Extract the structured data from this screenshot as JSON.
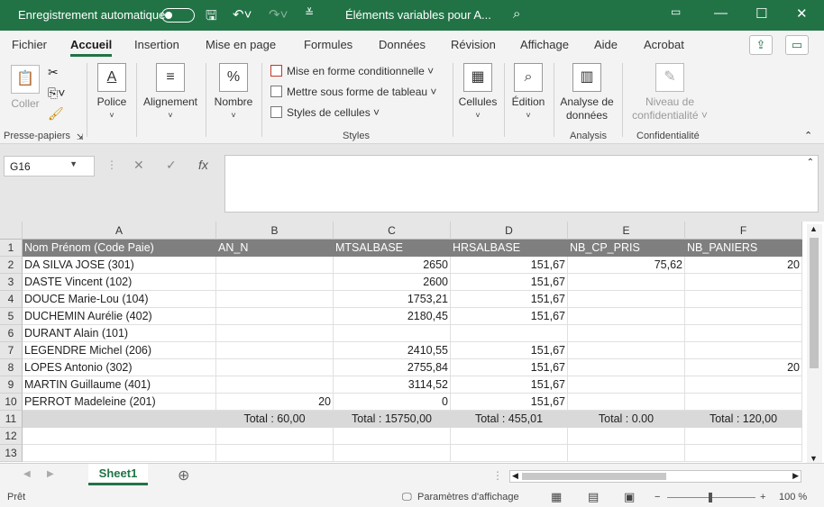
{
  "titlebar": {
    "autosave_label": "Enregistrement automatique",
    "doc_title": "Éléments variables pour A..."
  },
  "menu": {
    "tabs": [
      "Fichier",
      "Accueil",
      "Insertion",
      "Mise en page",
      "Formules",
      "Données",
      "Révision",
      "Affichage",
      "Aide",
      "Acrobat"
    ],
    "active": "Accueil"
  },
  "ribbon": {
    "coller": "Coller",
    "presse_papiers": "Presse-papiers",
    "police": "Police",
    "alignement": "Alignement",
    "nombre": "Nombre",
    "mise_en_forme": "Mise en forme conditionnelle",
    "mettre_tableau": "Mettre sous forme de tableau",
    "styles_cellules": "Styles de cellules",
    "styles": "Styles",
    "cellules": "Cellules",
    "edition": "Édition",
    "analyse1": "Analyse de",
    "analyse2": "données",
    "analysis": "Analysis",
    "niveau1": "Niveau de",
    "niveau2": "confidentialité",
    "confidentialite": "Confidentialité"
  },
  "formula": {
    "cell_ref": "G16",
    "fx": "fx"
  },
  "columns": [
    "A",
    "B",
    "C",
    "D",
    "E",
    "F"
  ],
  "header": [
    "Nom Prénom (Code Paie)",
    "AN_N",
    "MTSALBASE",
    "HRSALBASE",
    "NB_CP_PRIS",
    "NB_PANIERS"
  ],
  "rows": [
    [
      "DA SILVA JOSE (301)",
      "",
      "2650",
      "151,67",
      "75,62",
      "20"
    ],
    [
      "DASTE Vincent (102)",
      "",
      "2600",
      "151,67",
      "",
      ""
    ],
    [
      "DOUCE Marie-Lou (104)",
      "",
      "1753,21",
      "151,67",
      "",
      ""
    ],
    [
      "DUCHEMIN Aurélie (402)",
      "",
      "2180,45",
      "151,67",
      "",
      ""
    ],
    [
      "DURANT Alain (101)",
      "",
      "",
      "",
      "",
      ""
    ],
    [
      "LEGENDRE Michel (206)",
      "",
      "2410,55",
      "151,67",
      "",
      ""
    ],
    [
      "LOPES Antonio (302)",
      "",
      "2755,84",
      "151,67",
      "",
      "20"
    ],
    [
      "MARTIN Guillaume (401)",
      "",
      "3114,52",
      "151,67",
      "",
      ""
    ],
    [
      "PERROT Madeleine (201)",
      "20",
      "0",
      "151,67",
      "",
      ""
    ]
  ],
  "totals": [
    "",
    "Total : 60,00",
    "Total : 15750,00",
    "Total : 455,01",
    "Total : 0.00",
    "Total : 120,00"
  ],
  "row_numbers": [
    "1",
    "2",
    "3",
    "4",
    "5",
    "6",
    "7",
    "8",
    "9",
    "10",
    "11",
    "12",
    "13"
  ],
  "sheet": {
    "name": "Sheet1"
  },
  "status": {
    "ready": "Prêt",
    "display_settings": "Paramètres d'affichage",
    "zoom": "100 %",
    "minus": "−",
    "plus": "+"
  }
}
